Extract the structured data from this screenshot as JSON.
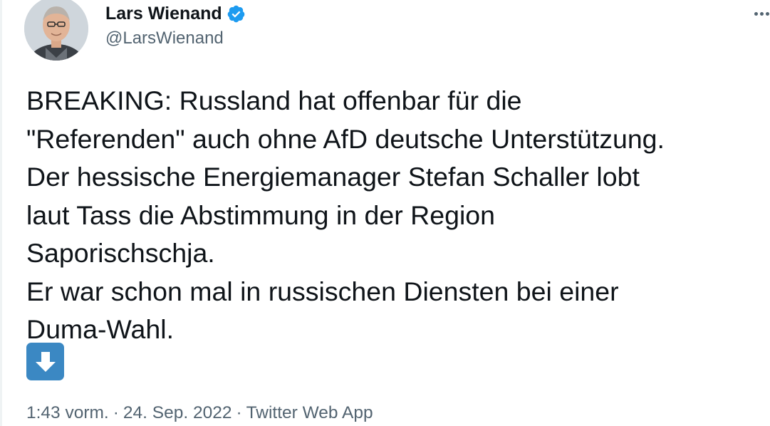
{
  "author": {
    "display_name": "Lars Wienand",
    "handle": "@LarsWienand",
    "verified": true
  },
  "tweet": {
    "text": "BREAKING: Russland hat offenbar für die\n\"Referenden\" auch ohne AfD deutsche Unterstützung.\nDer hessische Energiemanager Stefan Schaller lobt\nlaut Tass die Abstimmung in der Region\nSaporischschja.\nEr war schon mal in russischen Diensten bei einer\nDuma-Wahl.",
    "emoji": "down-arrow-emoji"
  },
  "meta": {
    "time": "1:43 vorm.",
    "separator": "·",
    "date": "24. Sep. 2022",
    "source": "Twitter Web App"
  },
  "colors": {
    "verified_blue": "#1d9bf0",
    "secondary_text": "#536471",
    "emoji_blue": "#3b88c3"
  },
  "icons": [
    "avatar-photo",
    "verified-badge-icon",
    "more-options-icon",
    "down-arrow-emoji"
  ]
}
